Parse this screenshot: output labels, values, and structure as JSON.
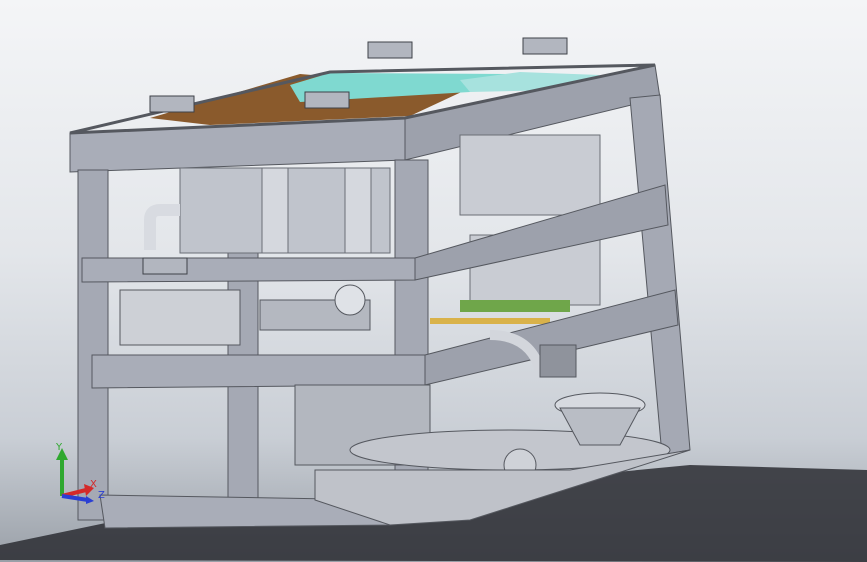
{
  "viewport": {
    "background_top": "#f4f5f7",
    "background_bottom": "#9aa0a8",
    "shadow_color": "#2b2d33"
  },
  "model": {
    "frame_color": "#a9adb8",
    "frame_dark": "#7f838e",
    "frame_light": "#c8ccd5",
    "panel_color": "#b9bdc6",
    "glass_color": "#7fd9d0",
    "wood_color": "#8a5a2c",
    "accent_green": "#6fa64a",
    "accent_gold": "#d9b24a"
  },
  "triad": {
    "y_label": "Y",
    "x_label": "X",
    "z_label": "Z",
    "y_color": "#2fa82f",
    "x_color": "#d42a2a",
    "z_color": "#2a3fd4",
    "icons": [
      "triad-y-arrow-icon",
      "triad-x-arrow-icon",
      "triad-z-arrow-icon"
    ]
  }
}
